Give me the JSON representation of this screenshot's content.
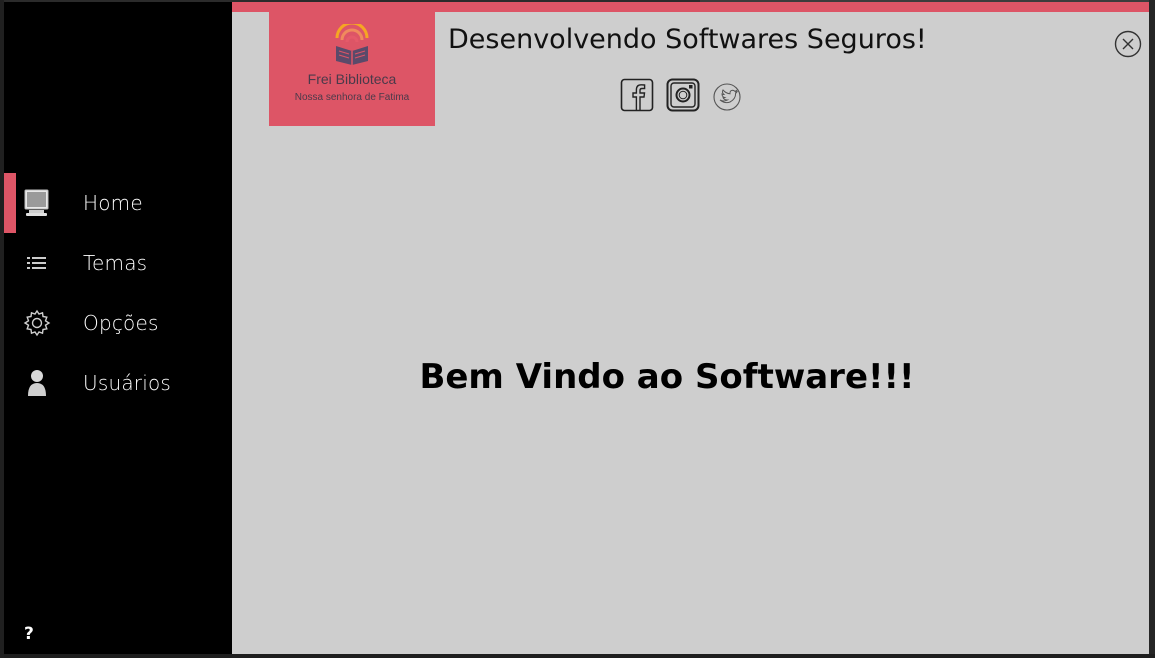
{
  "app": {
    "header_title": "Desenvolvendo Softwares Seguros!",
    "welcome_text": "Bem Vindo ao Software!!!",
    "accent_color": "#dd5566"
  },
  "logo": {
    "title": "Frei Biblioteca",
    "subtitle": "Nossa senhora de Fatima",
    "icon": "book-wifi-icon"
  },
  "sidebar": {
    "items": [
      {
        "label": "Home",
        "icon": "monitor-icon",
        "active": true
      },
      {
        "label": "Temas",
        "icon": "list-icon",
        "active": false
      },
      {
        "label": "Opções",
        "icon": "gear-icon",
        "active": false
      },
      {
        "label": "Usuários",
        "icon": "user-icon",
        "active": false
      }
    ],
    "help_label": "?"
  },
  "social": [
    {
      "name": "facebook-icon"
    },
    {
      "name": "instagram-icon"
    },
    {
      "name": "twitter-icon"
    }
  ],
  "window_controls": {
    "close_icon": "close-icon"
  }
}
